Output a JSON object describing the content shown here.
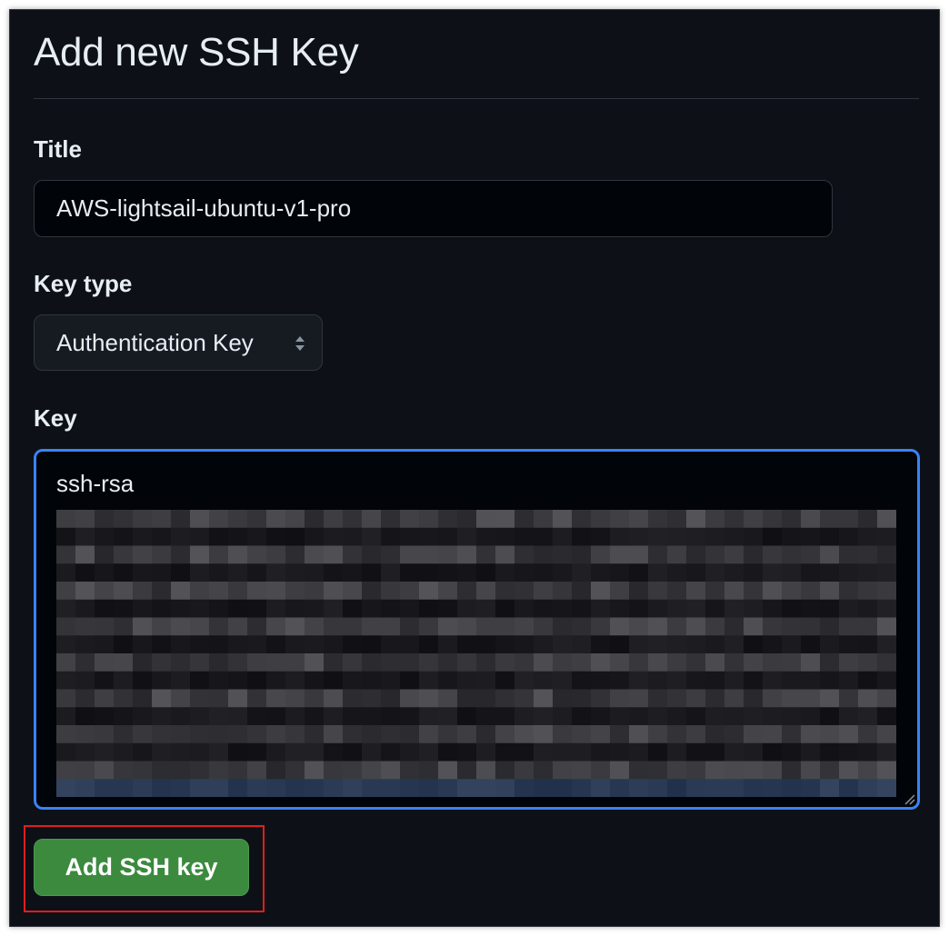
{
  "page": {
    "title": "Add new SSH Key"
  },
  "form": {
    "title_label": "Title",
    "title_value": "AWS-lightsail-ubuntu-v1-pro",
    "key_type_label": "Key type",
    "key_type_value": "Authentication Key",
    "key_label": "Key",
    "key_prefix": "ssh-rsa",
    "key_body_icon": "pixelated-redaction",
    "submit_label": "Add SSH key"
  },
  "colors": {
    "background": "#0d1117",
    "border": "#30363d",
    "focus_ring": "#3b82f6",
    "submit_button": "#3b8a3e",
    "highlight_box": "#e11d1d"
  }
}
